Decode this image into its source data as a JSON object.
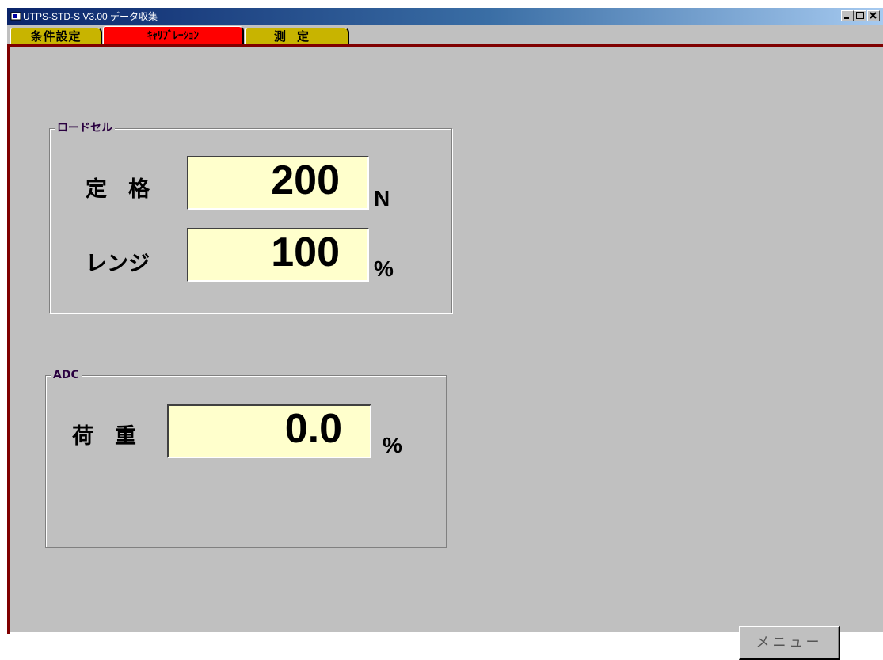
{
  "window": {
    "title": "UTPS-STD-S V3.00  データ収集"
  },
  "tabs": [
    {
      "label": "条件設定"
    },
    {
      "label": "ｷｬﾘﾌﾞﾚｰｼｮﾝ"
    },
    {
      "label": "測定"
    }
  ],
  "loadcell": {
    "caption": "ロードセル",
    "rated": {
      "label": "定　格",
      "value": "200",
      "unit": "N"
    },
    "range": {
      "label": "レンジ",
      "value": "100",
      "unit": "%"
    }
  },
  "adc": {
    "caption": "ADC",
    "load": {
      "label": "荷　重",
      "value": "0.0",
      "unit": "%"
    }
  },
  "menu_button": {
    "label": "メニュー"
  },
  "colors": {
    "tab_inactive": "#c8b400",
    "tab_active": "#ff0000",
    "value_background": "#ffffcc",
    "panel_border": "#800000"
  }
}
